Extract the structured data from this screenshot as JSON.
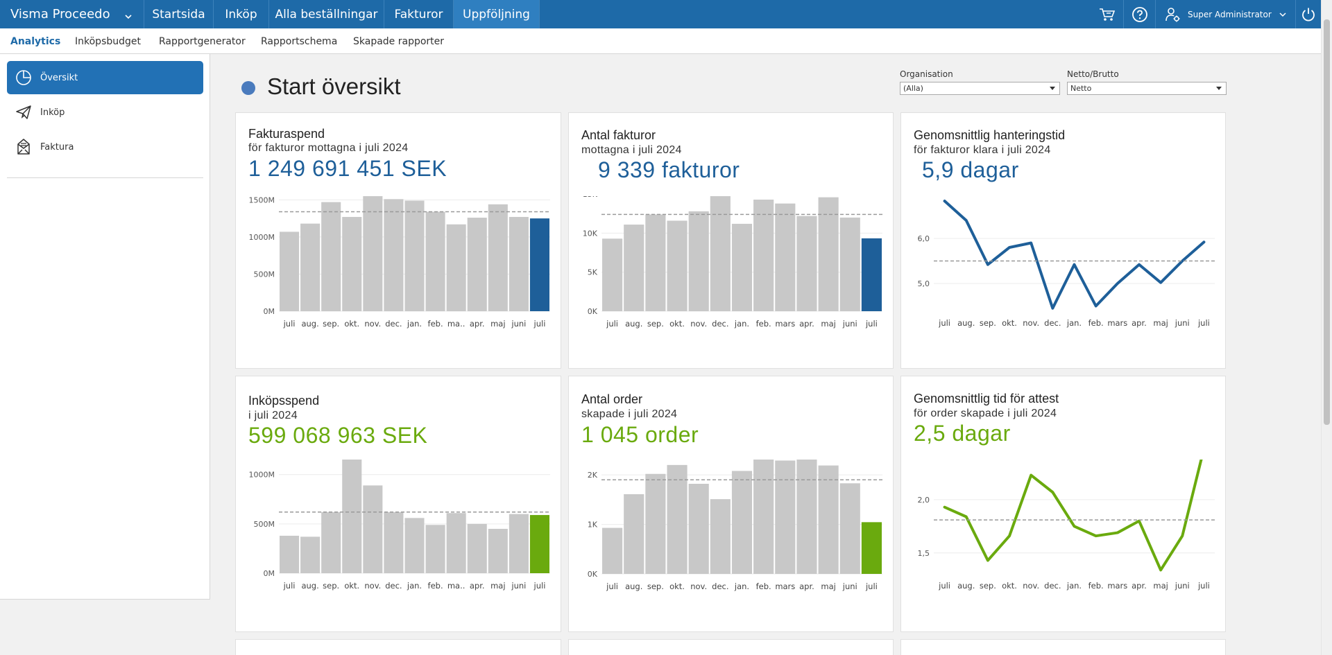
{
  "topbar": {
    "brand": "Visma Proceedo",
    "nav": [
      "Startsida",
      "Inköp",
      "Alla beställningar",
      "Fakturor",
      "Uppföljning"
    ],
    "active_nav": "Uppföljning",
    "user": "Super Administrator",
    "icons": [
      "cart-icon",
      "help-icon",
      "user-settings-icon",
      "power-icon"
    ]
  },
  "subnav": [
    "Analytics",
    "Inköpsbudget",
    "Rapportgenerator",
    "Rapportschema",
    "Skapade rapporter"
  ],
  "sidebar": [
    {
      "label": "Översikt",
      "icon": "pie-chart-icon",
      "active": true
    },
    {
      "label": "Inköp",
      "icon": "paper-plane-icon",
      "active": false
    },
    {
      "label": "Faktura",
      "icon": "invoice-icon",
      "active": false
    }
  ],
  "page": {
    "title": "Start översikt",
    "filters": [
      {
        "label": "Organisation",
        "value": "(Alla)"
      },
      {
        "label": "Netto/Brutto",
        "value": "Netto"
      }
    ]
  },
  "colors": {
    "blue": "#1e5f99",
    "green": "#6aaa0e",
    "grey_bar": "#c8c8c8",
    "topbar": "#1e6aa8"
  },
  "chart_data": [
    {
      "type": "bar",
      "title": "Fakturaspend",
      "subtitle": "för fakturor mottagna i juli 2024",
      "kpi": "1 249 691 451 SEK",
      "categories": [
        "juli",
        "aug.",
        "sep.",
        "okt.",
        "nov.",
        "dec.",
        "jan.",
        "feb.",
        "ma..",
        "apr.",
        "maj",
        "juni",
        "juli"
      ],
      "values": [
        1070,
        1180,
        1470,
        1270,
        1590,
        1510,
        1490,
        1340,
        1170,
        1260,
        1440,
        1270,
        1250
      ],
      "unit": "M",
      "average": 1340,
      "yticks": [
        0,
        500,
        1000,
        1500
      ],
      "ytick_labels": [
        "0M",
        "500M",
        "1000M",
        "1500M"
      ],
      "ylim": [
        0,
        1550
      ],
      "highlight_color": "#1e5f99"
    },
    {
      "type": "bar",
      "title": "Antal fakturor",
      "subtitle": "mottagna i juli 2024",
      "kpi": "9 339 fakturor",
      "categories": [
        "juli",
        "aug.",
        "sep.",
        "okt.",
        "nov.",
        "dec.",
        "jan.",
        "feb.",
        "mars",
        "apr.",
        "maj",
        "juni",
        "juli"
      ],
      "values": [
        9300,
        11100,
        12400,
        11600,
        12800,
        14800,
        11200,
        14300,
        13800,
        12200,
        14600,
        12000,
        9339
      ],
      "average": 12400,
      "yticks": [
        0,
        5000,
        10000,
        15000
      ],
      "ytick_labels": [
        "0K",
        "5K",
        "10K",
        "15K"
      ],
      "ylim": [
        0,
        15100
      ],
      "highlight_color": "#1e5f99"
    },
    {
      "type": "line",
      "title": "Genomsnittlig hanteringstid",
      "subtitle": "för fakturor klara i juli 2024",
      "kpi": "5,9 dagar",
      "categories": [
        "juli",
        "aug.",
        "sep.",
        "okt.",
        "nov.",
        "dec.",
        "jan.",
        "feb.",
        "mars",
        "apr.",
        "maj",
        "juni",
        "juli"
      ],
      "values": [
        6.83,
        6.4,
        5.42,
        5.8,
        5.9,
        4.45,
        5.42,
        4.5,
        5.0,
        5.42,
        5.02,
        5.5,
        5.92
      ],
      "average": 5.5,
      "yticks": [
        5.0,
        6.0
      ],
      "ytick_labels": [
        "5,0",
        "6,0"
      ],
      "ylim": [
        4.4,
        7.0
      ],
      "color": "#1e5f99"
    },
    {
      "type": "bar",
      "title": "Inköpsspend",
      "subtitle": "i juli 2024",
      "kpi": "599 068 963 SEK",
      "categories": [
        "juli",
        "aug.",
        "sep.",
        "okt.",
        "nov.",
        "dec.",
        "jan.",
        "feb.",
        "ma..",
        "apr.",
        "maj",
        "juni",
        "juli"
      ],
      "values": [
        380,
        370,
        620,
        1200,
        890,
        620,
        560,
        490,
        610,
        500,
        450,
        600,
        590
      ],
      "unit": "M",
      "average": 620,
      "yticks": [
        0,
        500,
        1000
      ],
      "ytick_labels": [
        "0M",
        "500M",
        "1000M"
      ],
      "ylim": [
        0,
        1230
      ],
      "highlight_color": "#6aaa0e"
    },
    {
      "type": "bar",
      "title": "Antal order",
      "subtitle": "skapade i juli 2024",
      "kpi": "1 045 order",
      "categories": [
        "juli",
        "aug.",
        "sep.",
        "okt.",
        "nov.",
        "dec.",
        "jan.",
        "feb.",
        "mars",
        "apr.",
        "maj",
        "juni",
        "juli"
      ],
      "values": [
        930,
        1610,
        2020,
        2200,
        1820,
        1510,
        2080,
        2490,
        2290,
        2360,
        2190,
        1830,
        1045
      ],
      "average": 1900,
      "yticks": [
        0,
        1000,
        2000
      ],
      "ytick_labels": [
        "0K",
        "1K",
        "2K"
      ],
      "ylim": [
        0,
        2520
      ],
      "highlight_color": "#6aaa0e"
    },
    {
      "type": "line",
      "title": "Genomsnittlig tid för attest",
      "subtitle": "för order skapade i juli 2024",
      "kpi": "2,5 dagar",
      "categories": [
        "juli",
        "aug.",
        "sep.",
        "okt.",
        "nov.",
        "dec.",
        "jan.",
        "feb.",
        "mars",
        "apr.",
        "maj",
        "juni",
        "juli"
      ],
      "values": [
        1.93,
        1.84,
        1.43,
        1.66,
        2.23,
        2.07,
        1.75,
        1.66,
        1.69,
        1.8,
        1.34,
        1.66,
        2.48
      ],
      "average": 1.81,
      "yticks": [
        1.5,
        2.0,
        2.5
      ],
      "ytick_labels": [
        "1,5",
        "2,0",
        "2,5"
      ],
      "ylim": [
        1.31,
        2.5
      ],
      "color": "#6aaa0e"
    }
  ]
}
